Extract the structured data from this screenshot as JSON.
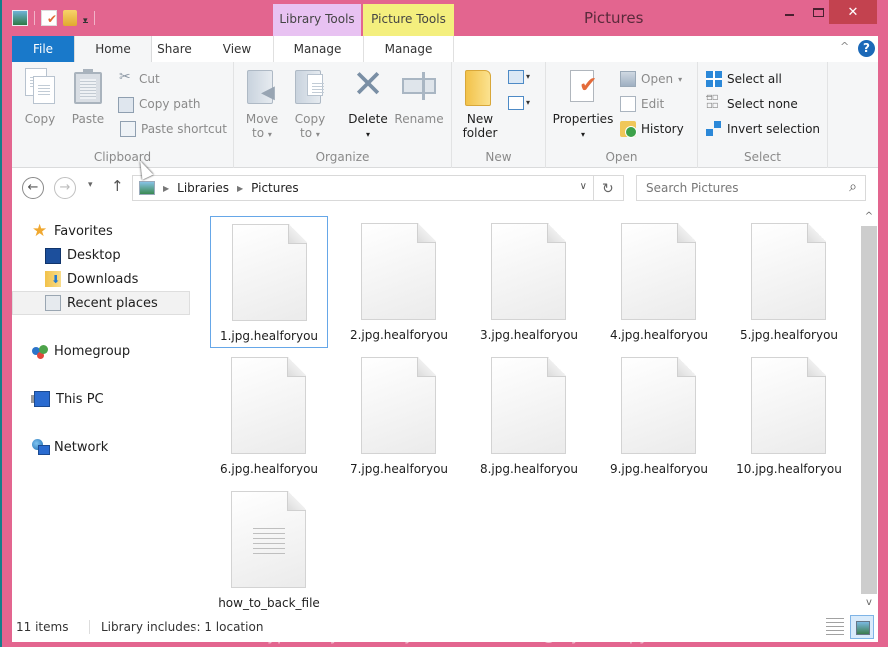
{
  "window": {
    "title": "Pictures",
    "minimize_label": "",
    "close_glyph": "✕",
    "frame_color": "#e3658f"
  },
  "quick_access": {
    "icons": [
      "pictures-library-icon",
      "properties-icon",
      "new-folder-icon",
      "customize-dropdown-icon"
    ],
    "dropdown_glyph": "▾"
  },
  "context_tabs": {
    "library_tools": "Library Tools",
    "picture_tools": "Picture Tools"
  },
  "ribbon_tabs": [
    {
      "label": "File",
      "active": false
    },
    {
      "label": "Home",
      "active": true
    },
    {
      "label": "Share",
      "active": false
    },
    {
      "label": "View",
      "active": false
    },
    {
      "label": "Manage",
      "active": false
    },
    {
      "label": "Manage",
      "active": false
    }
  ],
  "ribbon": {
    "collapse_glyph": "^",
    "help_glyph": "?",
    "clipboard": {
      "label": "Clipboard",
      "copy": "Copy",
      "paste": "Paste",
      "cut": "Cut",
      "copy_path": "Copy path",
      "paste_shortcut": "Paste shortcut"
    },
    "organize": {
      "label": "Organize",
      "move_to": "Move",
      "move_to_2": "to",
      "copy_to": "Copy",
      "copy_to_2": "to",
      "delete": "Delete",
      "rename": "Rename"
    },
    "new": {
      "label": "New",
      "new_folder": "New",
      "new_folder_2": "folder"
    },
    "open": {
      "label": "Open",
      "properties": "Properties",
      "open": "Open",
      "edit": "Edit",
      "history": "History"
    },
    "select": {
      "label": "Select",
      "select_all": "Select all",
      "select_none": "Select none",
      "invert_selection": "Invert selection"
    },
    "dropdown_glyph": "▾"
  },
  "navigation": {
    "back_glyph": "←",
    "forward_glyph": "→",
    "recent_glyph": "▾",
    "up_glyph": "↑",
    "breadcrumb": [
      "Libraries",
      "Pictures"
    ],
    "crumb_sep": "▶",
    "address_dropdown_glyph": "∨",
    "refresh_glyph": "↻",
    "search_placeholder": "Search Pictures",
    "search_glyph": "⌕"
  },
  "sidebar": {
    "favorites": "Favorites",
    "items": [
      {
        "label": "Desktop"
      },
      {
        "label": "Downloads"
      },
      {
        "label": "Recent places",
        "selected": true
      }
    ],
    "homegroup": "Homegroup",
    "this_pc": "This PC",
    "network": "Network"
  },
  "files": [
    {
      "name": "1.jpg.healforyou",
      "type": "blank",
      "selected": true
    },
    {
      "name": "2.jpg.healforyou",
      "type": "blank"
    },
    {
      "name": "3.jpg.healforyou",
      "type": "blank"
    },
    {
      "name": "4.jpg.healforyou",
      "type": "blank"
    },
    {
      "name": "5.jpg.healforyou",
      "type": "blank"
    },
    {
      "name": "6.jpg.healforyou",
      "type": "blank"
    },
    {
      "name": "7.jpg.healforyou",
      "type": "blank"
    },
    {
      "name": "8.jpg.healforyou",
      "type": "blank"
    },
    {
      "name": "9.jpg.healforyou",
      "type": "blank"
    },
    {
      "name": "10.jpg.healforyou",
      "type": "blank"
    },
    {
      "name": "how_to_back_file",
      "type": "text"
    }
  ],
  "scrollbar": {
    "up_glyph": "^",
    "down_glyph": "v"
  },
  "status": {
    "item_count": "11 items",
    "library_info": "Library includes: 1 location"
  },
  "watermark": "files encrypted by Healforyou ransomware@My AntiSpyware"
}
